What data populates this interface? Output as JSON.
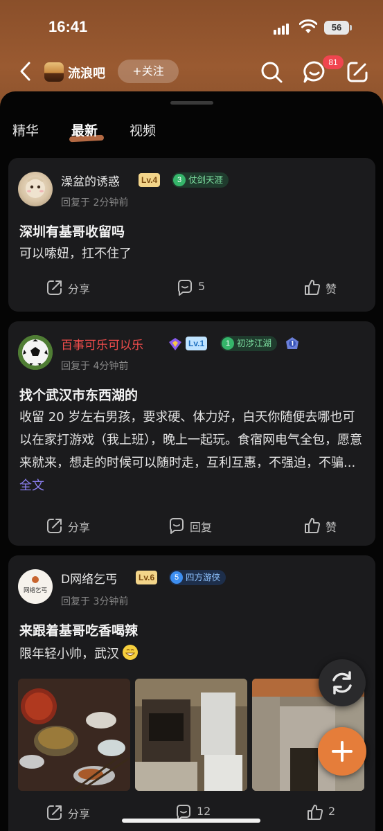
{
  "status_bar": {
    "time": "16:41",
    "battery": "56"
  },
  "nav": {
    "forum_name": "流浪吧",
    "follow_label": "+关注",
    "message_badge": "81"
  },
  "tabs": [
    {
      "label": "精华"
    },
    {
      "label": "最新"
    },
    {
      "label": "视频"
    }
  ],
  "posts": [
    {
      "username": "澡盆的诱惑",
      "level": "Lv.4",
      "rank_num": "3",
      "rank_title": "仗剑天涯",
      "time": "回复于 2分钟前",
      "title": "深圳有基哥收留吗",
      "body": "可以嗦妞，扛不住了",
      "actions": {
        "share": "分享",
        "comment": "5",
        "like": "赞"
      }
    },
    {
      "username": "百事可乐可以乐",
      "level": "Lv.1",
      "rank_num": "1",
      "rank_title": "初涉江湖",
      "time": "回复于 4分钟前",
      "title": "找个武汉市东西湖的",
      "body": "收留 20 岁左右男孩，要求硬、体力好，白天你随便去哪也可以在家打游戏（我上班），晚上一起玩。食宿网电气全包，愿意来就来，想走的时候可以随时走，互利互惠，不强迫，不骗...",
      "fulltext": "全文",
      "actions": {
        "share": "分享",
        "comment": "回复",
        "like": "赞"
      }
    },
    {
      "username": "D网络乞丐",
      "avatar_text": "网络乞丐",
      "level": "Lv.6",
      "rank_num": "5",
      "rank_title": "四方游侠",
      "time": "回复于 3分钟前",
      "title": "来跟着基哥吃香喝辣",
      "body": "限年轻小帅，武汉",
      "actions": {
        "share": "分享",
        "comment": "12",
        "like": "2"
      }
    }
  ],
  "colors": {
    "header": "#8f532c",
    "accent": "#e57d3a",
    "badge": "#f0454f",
    "username_red": "#f04c4c",
    "fulltext": "#8b7ff0"
  }
}
